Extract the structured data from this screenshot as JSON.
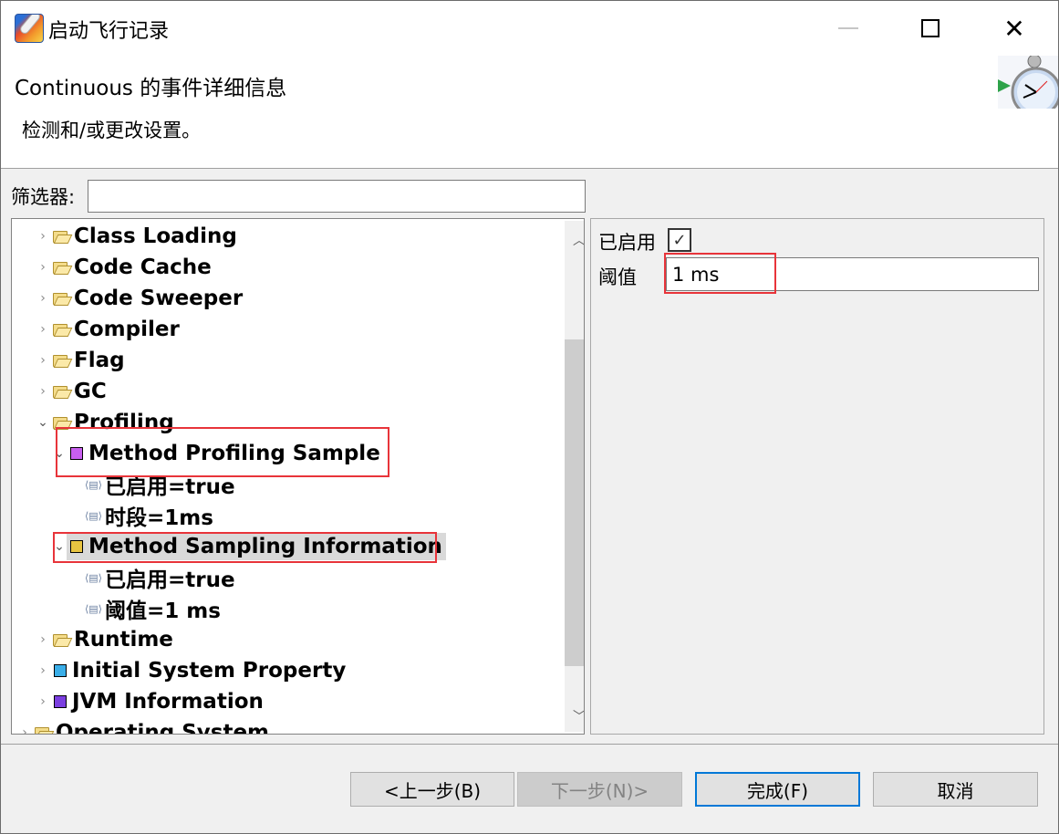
{
  "window": {
    "title": "启动飞行记录",
    "icon": "flight-recorder-icon",
    "controls": {
      "minimize": "minimize-icon",
      "maximize": "maximize-icon",
      "close": "close-icon",
      "close_glyph": "✕"
    }
  },
  "header": {
    "title": "Continuous 的事件详细信息",
    "description": "检测和/或更改设置。",
    "icon": "stopwatch-icon"
  },
  "filter": {
    "label": "筛选器:",
    "value": "",
    "placeholder": ""
  },
  "tree": {
    "items": [
      {
        "label": "Class Loading",
        "type": "folder",
        "level": 1,
        "expanded": false
      },
      {
        "label": "Code Cache",
        "type": "folder",
        "level": 1,
        "expanded": false
      },
      {
        "label": "Code Sweeper",
        "type": "folder",
        "level": 1,
        "expanded": false
      },
      {
        "label": "Compiler",
        "type": "folder",
        "level": 1,
        "expanded": false
      },
      {
        "label": "Flag",
        "type": "folder",
        "level": 1,
        "expanded": false
      },
      {
        "label": "GC",
        "type": "folder",
        "level": 1,
        "expanded": false
      },
      {
        "label": "Profiling",
        "type": "folder",
        "level": 1,
        "expanded": true
      },
      {
        "label": "Method Profiling Sample",
        "type": "event",
        "color": "#c95ff0",
        "level": 2,
        "expanded": true,
        "highlighted": true
      },
      {
        "label": "已启用=true",
        "type": "property",
        "level": 3
      },
      {
        "label": "时段=1ms",
        "type": "property",
        "level": 3
      },
      {
        "label": "Method Sampling Information",
        "type": "event",
        "color": "#e8c441",
        "level": 2,
        "expanded": true,
        "highlighted": true,
        "selected": true
      },
      {
        "label": "已启用=true",
        "type": "property",
        "level": 3
      },
      {
        "label": "阈值=1 ms",
        "type": "property",
        "level": 3
      },
      {
        "label": "Runtime",
        "type": "folder",
        "level": 1,
        "expanded": false
      },
      {
        "label": "Initial System Property",
        "type": "event",
        "color": "#3aaee8",
        "level": 1,
        "expanded": false
      },
      {
        "label": "JVM Information",
        "type": "event",
        "color": "#7b3fe0",
        "level": 1,
        "expanded": false
      },
      {
        "label": "Operating System",
        "type": "folder",
        "level": 0,
        "expanded": false
      }
    ],
    "scroll": {
      "thumb_start_fraction": 0.19,
      "thumb_size_fraction": 0.64
    },
    "glyphs": {
      "collapsed": "›",
      "expanded": "⌄",
      "property": "⟨▤⟩",
      "scroll_up": "︿",
      "scroll_down": "﹀"
    }
  },
  "details": {
    "enabled_label": "已启用",
    "enabled_checked": true,
    "check_glyph": "✓",
    "threshold_label": "阈值",
    "threshold_value": "1 ms"
  },
  "buttons": {
    "back": "<上一步(B)",
    "next": "下一步(N)>",
    "finish": "完成(F)",
    "cancel": "取消"
  },
  "colors": {
    "highlight": "#e8343a",
    "focus": "#0078d7"
  }
}
